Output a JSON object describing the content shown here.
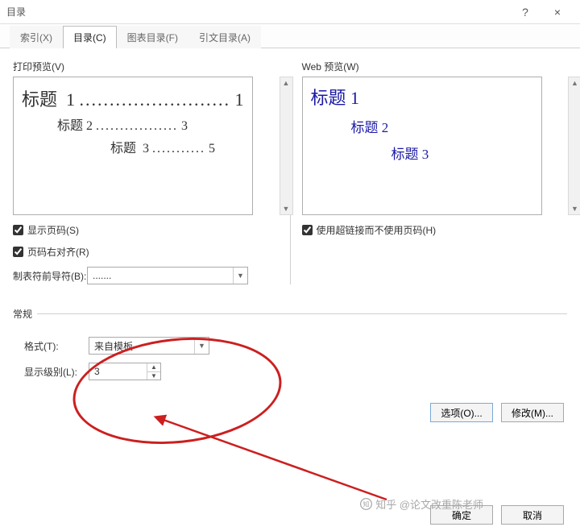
{
  "titlebar": {
    "title": "目录",
    "help": "?",
    "close": "×"
  },
  "tabs": {
    "index": "索引(X)",
    "toc": "目录(C)",
    "figures": "图表目录(F)",
    "auth": "引文目录(A)"
  },
  "print_preview": {
    "label": "打印预览(V)",
    "l1_title": "标题",
    "l1_num": "1",
    "l1_dots": ".........................",
    "l1_page": "1",
    "l2_title": "标题",
    "l2_num": "2",
    "l2_dots": ".................",
    "l2_page": "3",
    "l3_title": "标题",
    "l3_num": "3",
    "l3_dots": "...........",
    "l3_page": "5"
  },
  "web_preview": {
    "label": "Web 预览(W)",
    "l1": "标题  1",
    "l2": "标题  2",
    "l3": "标题  3"
  },
  "opts": {
    "show_page": "显示页码(S)",
    "align_right": "页码右对齐(R)",
    "use_hyperlinks": "使用超链接而不使用页码(H)",
    "leader_label": "制表符前导符(B):",
    "leader_value": "......."
  },
  "general": {
    "section": "常规",
    "format_label": "格式(T):",
    "format_value": "来自模板",
    "levels_label": "显示级别(L):",
    "levels_value": "3"
  },
  "buttons": {
    "options": "选项(O)...",
    "modify": "修改(M)...",
    "ok": "确定",
    "cancel": "取消"
  },
  "watermark": "知乎 @论文改重陈老师"
}
